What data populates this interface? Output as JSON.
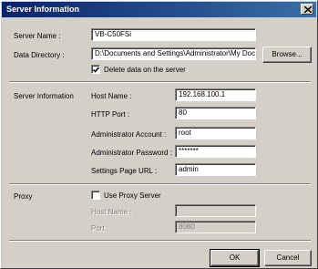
{
  "window": {
    "title": "Server Information"
  },
  "server": {
    "name_label": "Server Name :",
    "name_value": "VB-C50FSi",
    "dir_label": "Data Directory :",
    "dir_value": "D:\\Documents and Settings\\Administrator\\My Docume",
    "browse_label": "Browse...",
    "delete_label": "Delete data on the server",
    "delete_checked": true
  },
  "server_info": {
    "section_label": "Server Information",
    "host_label": "Host Name :",
    "host_value": "192.168.100.1",
    "port_label": "HTTP Port :",
    "port_value": "80",
    "account_label": "Administrator Account :",
    "account_value": "root",
    "password_label": "Administrator Password :",
    "password_value": "*******",
    "url_label": "Settings Page URL :",
    "url_value": "admin"
  },
  "proxy": {
    "section_label": "Proxy",
    "use_label": "Use Proxy Server",
    "use_checked": false,
    "host_label": "Host Name :",
    "host_value": "",
    "port_label": "Port :",
    "port_value": "8080"
  },
  "footer": {
    "ok_label": "OK",
    "cancel_label": "Cancel"
  }
}
